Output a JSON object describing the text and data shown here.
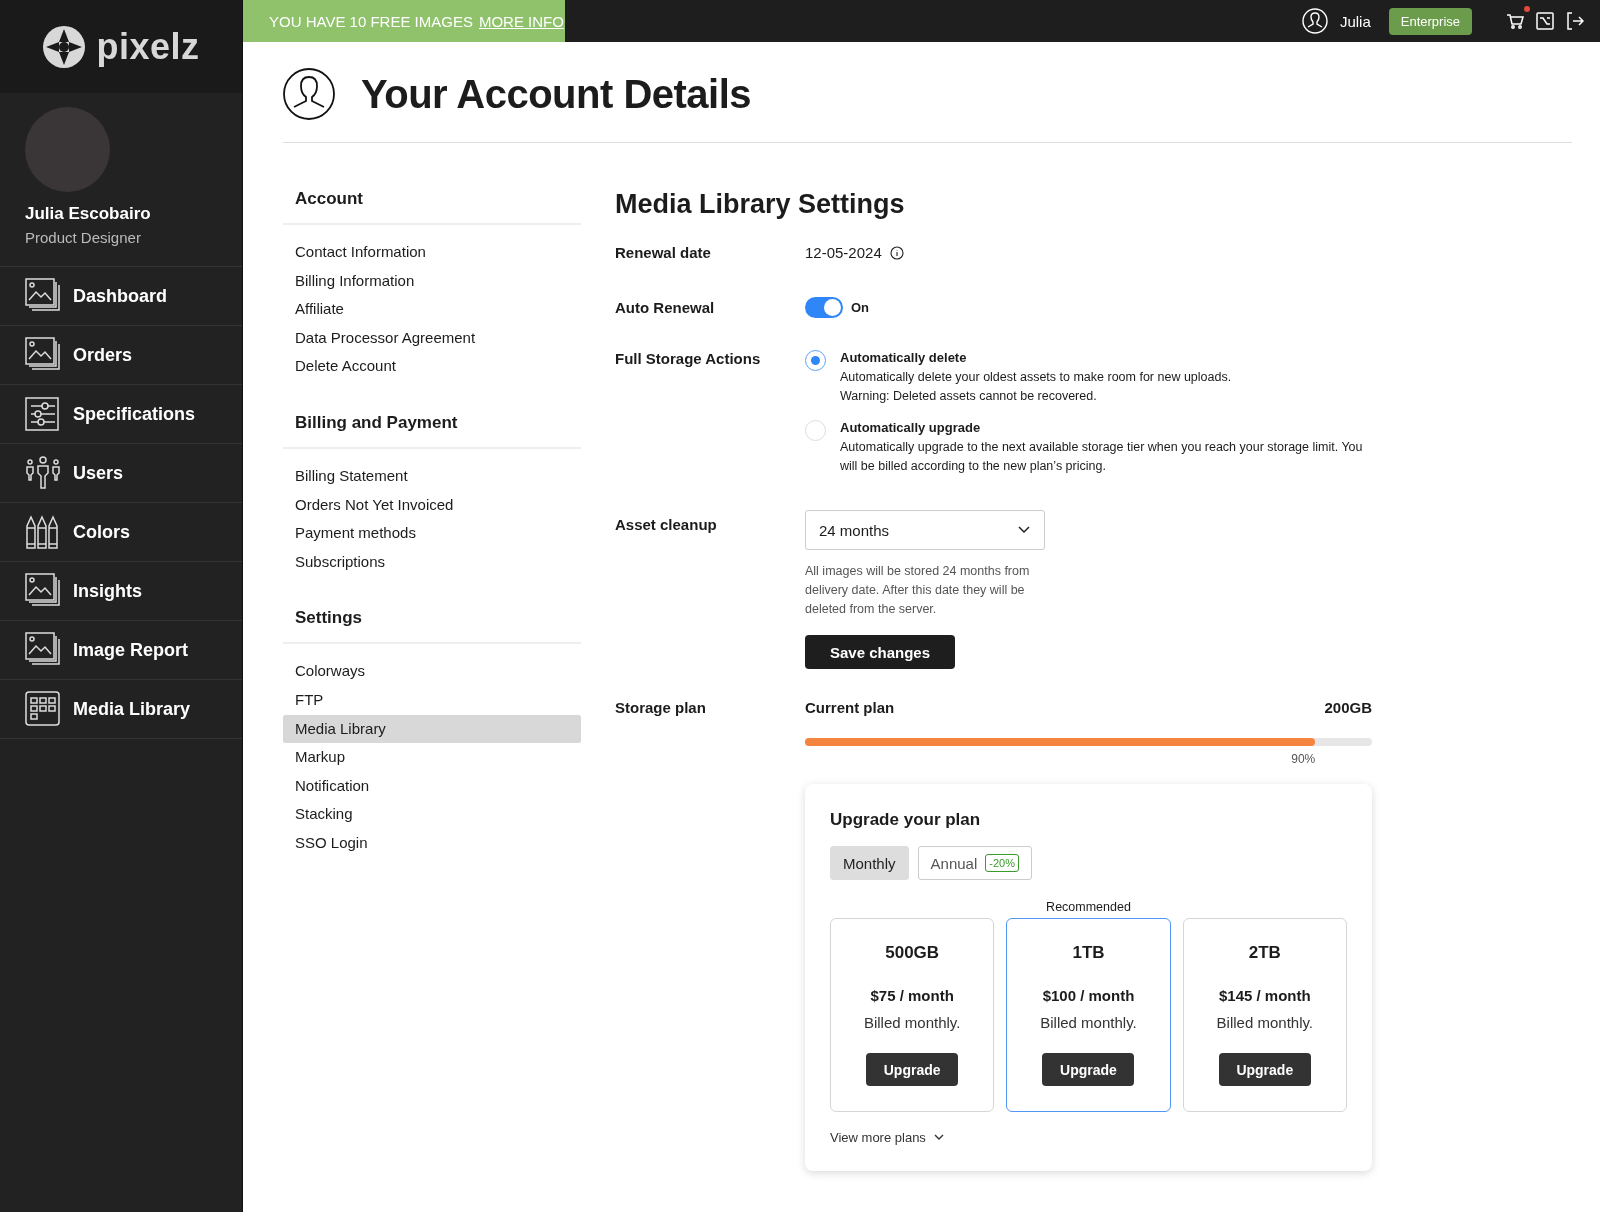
{
  "banner": {
    "text": "YOU HAVE 10 FREE IMAGES",
    "link": "MORE INFO"
  },
  "topbar": {
    "user": "Julia",
    "plan": "Enterprise",
    "cart_notification": true
  },
  "logo": {
    "text": "pixelz"
  },
  "profile": {
    "name": "Julia Escobairo",
    "role": "Product Designer"
  },
  "nav": [
    {
      "label": "Dashboard",
      "kind": "images"
    },
    {
      "label": "Orders",
      "kind": "images"
    },
    {
      "label": "Specifications",
      "kind": "sliders"
    },
    {
      "label": "Users",
      "kind": "users"
    },
    {
      "label": "Colors",
      "kind": "crayons"
    },
    {
      "label": "Insights",
      "kind": "images"
    },
    {
      "label": "Image Report",
      "kind": "images"
    },
    {
      "label": "Media Library",
      "kind": "grid"
    }
  ],
  "page_title": "Your Account Details",
  "settings_nav": [
    {
      "heading": "Account",
      "items": [
        {
          "label": "Contact Information",
          "selected": false
        },
        {
          "label": "Billing Information",
          "selected": false
        },
        {
          "label": "Affiliate",
          "selected": false
        },
        {
          "label": "Data Processor Agreement",
          "selected": false
        },
        {
          "label": "Delete Account",
          "selected": false
        }
      ]
    },
    {
      "heading": "Billing and Payment",
      "items": [
        {
          "label": "Billing Statement",
          "selected": false
        },
        {
          "label": "Orders Not Yet Invoiced",
          "selected": false
        },
        {
          "label": "Payment methods",
          "selected": false
        },
        {
          "label": "Subscriptions",
          "selected": false
        }
      ]
    },
    {
      "heading": "Settings",
      "items": [
        {
          "label": "Colorways",
          "selected": false
        },
        {
          "label": "FTP",
          "selected": false
        },
        {
          "label": "Media Library",
          "selected": true
        },
        {
          "label": "Markup",
          "selected": false
        },
        {
          "label": "Notification",
          "selected": false
        },
        {
          "label": "Stacking",
          "selected": false
        },
        {
          "label": "SSO Login",
          "selected": false
        }
      ]
    }
  ],
  "section_title": "Media Library Settings",
  "renewal": {
    "label": "Renewal date",
    "value": "12-05-2024"
  },
  "auto_renewal": {
    "label": "Auto Renewal",
    "on": true,
    "state_label": "On"
  },
  "storage_actions": {
    "label": "Full Storage Actions",
    "options": [
      {
        "title": "Automatically delete",
        "lines": [
          "Automatically delete your oldest assets to make room for new uploads.",
          "Warning: Deleted assets cannot be recovered."
        ],
        "selected": true
      },
      {
        "title": "Automatically upgrade",
        "lines": [
          "Automatically upgrade to the next available storage tier when you reach your storage limit. You will be billed according to the new plan’s pricing."
        ],
        "selected": false
      }
    ]
  },
  "asset_cleanup": {
    "label": "Asset cleanup",
    "value": "24 months",
    "help": "All images will be stored 24 months from delivery date. After this date they will be deleted from the server."
  },
  "save_button": "Save changes",
  "storage_plan": {
    "label": "Storage plan",
    "current_label": "Current plan",
    "total": "200GB",
    "level": 0.9,
    "percent": "90%"
  },
  "upgrade": {
    "title": "Upgrade your plan",
    "billing": [
      {
        "label": "Monthly",
        "selected": true
      },
      {
        "label": "Annual",
        "badge": "-20%",
        "selected": false
      }
    ],
    "plans": [
      {
        "size": "500GB",
        "price": "$75 / month",
        "billing": "Billed monthly.",
        "button": "Upgrade",
        "recommended": false
      },
      {
        "size": "1TB",
        "price": "$100 / month",
        "billing": "Billed monthly.",
        "button": "Upgrade",
        "recommended": true,
        "recommended_label": "Recommended"
      },
      {
        "size": "2TB",
        "price": "$145 / month",
        "billing": "Billed monthly.",
        "button": "Upgrade",
        "recommended": false
      }
    ],
    "more": "View more plans"
  }
}
